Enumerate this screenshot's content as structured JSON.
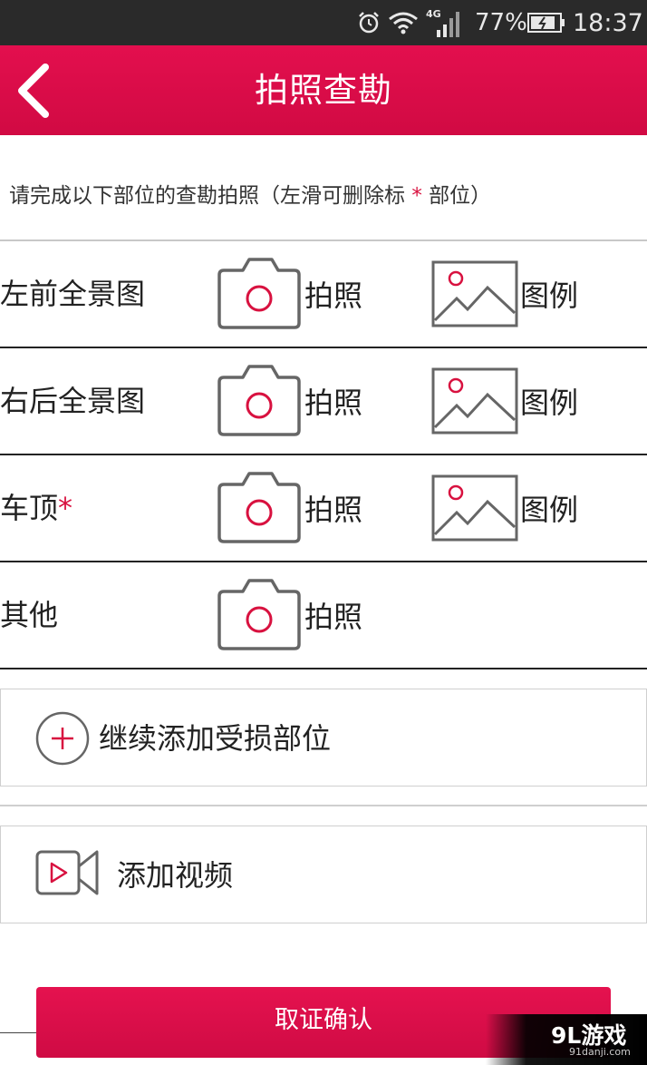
{
  "status_bar": {
    "network_label": "4G",
    "battery_percent": "77%",
    "time": "18:37"
  },
  "header": {
    "title": "拍照查勘"
  },
  "instruction": {
    "text_before": "请完成以下部位的查勘拍照（左滑可删除标 ",
    "star": "*",
    "text_after": " 部位）"
  },
  "rows": [
    {
      "label": "左前全景图",
      "required_mark": "",
      "photo_label": "拍照",
      "example_label": "图例"
    },
    {
      "label": "右后全景图",
      "required_mark": "",
      "photo_label": "拍照",
      "example_label": "图例"
    },
    {
      "label": "车顶",
      "required_mark": "*",
      "photo_label": "拍照",
      "example_label": "图例"
    },
    {
      "label": "其他",
      "required_mark": "",
      "photo_label": "拍照"
    }
  ],
  "add_part": {
    "label": "继续添加受损部位"
  },
  "add_video": {
    "label": "添加视频"
  },
  "confirm_button": {
    "label": "取证确认"
  },
  "watermark": {
    "logo": "9L游戏",
    "url": "91danji.com"
  },
  "colors": {
    "brand_red": "#d90d47",
    "text": "#222222",
    "icon_gray": "#666666"
  },
  "icons": [
    "alarm-icon",
    "wifi-icon",
    "signal-icon",
    "battery-icon",
    "back-chevron-icon",
    "camera-icon",
    "image-example-icon",
    "plus-circle-icon",
    "video-camera-icon"
  ]
}
